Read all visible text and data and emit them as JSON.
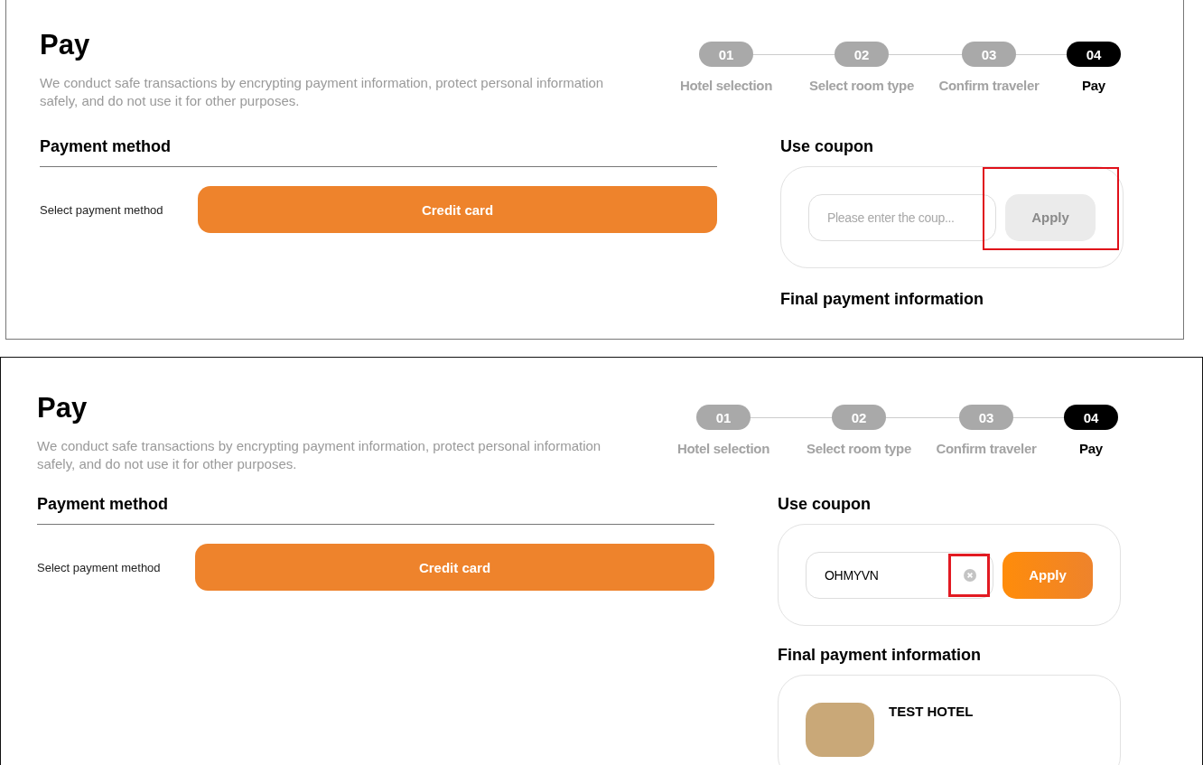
{
  "panels": [
    {
      "title": "Pay",
      "description": "We conduct safe transactions by encrypting payment information, protect personal information safely, and do not use it for other purposes.",
      "steps": [
        {
          "number": "01",
          "label": "Hotel selection",
          "selected": false
        },
        {
          "number": "02",
          "label": "Select room type",
          "selected": false
        },
        {
          "number": "03",
          "label": "Confirm traveler",
          "selected": false
        },
        {
          "number": "04",
          "label": "Pay",
          "selected": true
        }
      ],
      "payment": {
        "heading": "Payment method",
        "label": "Select payment method",
        "method": "Credit card"
      },
      "coupon": {
        "heading": "Use coupon",
        "placeholder": "Please enter the coup...",
        "apply": "Apply",
        "apply_enabled": false,
        "highlight_apply": true
      },
      "final": {
        "heading": "Final payment information"
      }
    },
    {
      "title": "Pay",
      "description": "We conduct safe transactions by encrypting payment information, protect personal information safely, and do not use it for other purposes.",
      "steps": [
        {
          "number": "01",
          "label": "Hotel selection",
          "selected": false
        },
        {
          "number": "02",
          "label": "Select room type",
          "selected": false
        },
        {
          "number": "03",
          "label": "Confirm traveler",
          "selected": false
        },
        {
          "number": "04",
          "label": "Pay",
          "selected": true
        }
      ],
      "payment": {
        "heading": "Payment method",
        "label": "Select payment method",
        "method": "Credit card"
      },
      "coupon": {
        "heading": "Use coupon",
        "value": "OHMYVN",
        "clear_button": true,
        "apply": "Apply",
        "apply_enabled": true,
        "highlight_clear": true
      },
      "final": {
        "heading": "Final payment information",
        "hotel_name": "TEST HOTEL"
      }
    }
  ]
}
